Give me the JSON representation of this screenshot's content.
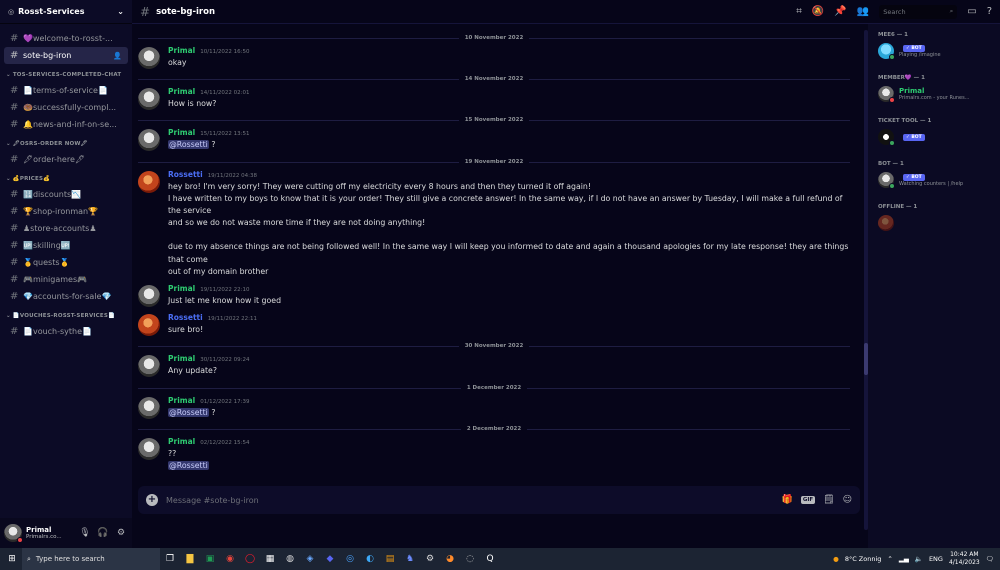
{
  "server": {
    "name": "Rosst-Services"
  },
  "sidebar": {
    "items": [
      {
        "type": "channel",
        "label": "💜welcome-to-rosst-..."
      },
      {
        "type": "channel",
        "label": "sote-bg-iron",
        "active": true
      },
      {
        "type": "category",
        "label": "TOS-SERVICES-COMPLETED-CHAT"
      },
      {
        "type": "channel",
        "label": "📄terms-of-service📄"
      },
      {
        "type": "channel",
        "label": "🍩successfully-compl..."
      },
      {
        "type": "channel",
        "label": "🔔news-and-inf-on-se..."
      },
      {
        "type": "category",
        "label": "🖋OSRS-ORDER NOW🖋"
      },
      {
        "type": "channel",
        "label": "🖋order-here🖋"
      },
      {
        "type": "category",
        "label": "💰PRICES💰"
      },
      {
        "type": "channel",
        "label": "🔢discounts📉"
      },
      {
        "type": "channel",
        "label": "🏆shop-ironman🏆"
      },
      {
        "type": "channel",
        "label": "♟store-accounts♟"
      },
      {
        "type": "channel",
        "label": "🆙skilling🆙"
      },
      {
        "type": "channel",
        "label": "🥇quests🥇"
      },
      {
        "type": "channel",
        "label": "🎮minigames🎮"
      },
      {
        "type": "channel",
        "label": "💎accounts-for-sale💎"
      },
      {
        "type": "category",
        "label": "📄VOUCHES-ROSST-SERVICES📄"
      },
      {
        "type": "channel",
        "label": "📄vouch-sythe📄"
      }
    ]
  },
  "user": {
    "name": "Primal",
    "status": "Primalrs.co..."
  },
  "channel": {
    "title": "sote-bg-iron"
  },
  "search": {
    "placeholder": "Search"
  },
  "messages": [
    {
      "type": "divider",
      "date": "10 November 2022"
    },
    {
      "type": "msg",
      "author": "Primal",
      "color": "green",
      "avatar": "gray",
      "time": "10/11/2022 16:50",
      "lines": [
        "okay"
      ]
    },
    {
      "type": "divider",
      "date": "14 November 2022"
    },
    {
      "type": "msg",
      "author": "Primal",
      "color": "green",
      "avatar": "gray",
      "time": "14/11/2022 02:01",
      "lines": [
        "How is now?"
      ]
    },
    {
      "type": "divider",
      "date": "15 November 2022"
    },
    {
      "type": "msg",
      "author": "Primal",
      "color": "green",
      "avatar": "gray",
      "time": "15/11/2022 13:51",
      "mention": "@Rossetti",
      "after": " ?"
    },
    {
      "type": "divider",
      "date": "19 November 2022"
    },
    {
      "type": "msg",
      "author": "Rossetti",
      "color": "blue",
      "avatar": "orange",
      "time": "19/11/2022 04:38",
      "lines": [
        "hey bro! I'm very sorry! They were cutting off my electricity every 8 hours and then they turned it off again!",
        "I have written to my boys to know that it is your order! They still give a concrete answer! In the same way, if I do not have an answer by Tuesday, I will make a full refund of the service",
        "and so we do not waste more time if they are not doing anything!",
        "",
        "due to my absence things are not being followed well! In the same way I will keep you informed to date and again a thousand apologies for my late response! they are things that come",
        "out of my domain brother"
      ]
    },
    {
      "type": "msg",
      "author": "Primal",
      "color": "green",
      "avatar": "gray",
      "time": "19/11/2022 22:10",
      "lines": [
        "Just let me know how it goed"
      ]
    },
    {
      "type": "msg",
      "author": "Rossetti",
      "color": "blue",
      "avatar": "orange",
      "time": "19/11/2022 22:11",
      "lines": [
        "sure bro!"
      ]
    },
    {
      "type": "divider",
      "date": "30 November 2022"
    },
    {
      "type": "msg",
      "author": "Primal",
      "color": "green",
      "avatar": "gray",
      "time": "30/11/2022 09:24",
      "lines": [
        "Any update?"
      ]
    },
    {
      "type": "divider",
      "date": "1 December 2022"
    },
    {
      "type": "msg",
      "author": "Primal",
      "color": "green",
      "avatar": "gray",
      "time": "01/12/2022 17:39",
      "mention": "@Rossetti",
      "after": " ?"
    },
    {
      "type": "divider",
      "date": "2 December 2022"
    },
    {
      "type": "msg",
      "author": "Primal",
      "color": "green",
      "avatar": "gray",
      "time": "02/12/2022 15:54",
      "lines": [
        "??"
      ],
      "mention2": "@Rossetti"
    }
  ],
  "composer": {
    "placeholder": "Message #sote-bg-iron"
  },
  "members": {
    "groups": [
      {
        "title": "MEE6 — 1",
        "entries": [
          {
            "name": "",
            "bot": "✓ BOT",
            "sub": "Playing /imagine",
            "avatar": "cyan",
            "nameColor": "white"
          }
        ]
      },
      {
        "title": "MEMBER💜 — 1",
        "entries": [
          {
            "name": "Primal",
            "bot": "",
            "sub": "Primalrs.com - your Runes...",
            "avatar": "gray",
            "nameColor": "green"
          }
        ]
      },
      {
        "title": "TICKET TOOL — 1",
        "entries": [
          {
            "name": "",
            "bot": "✓ BOT",
            "sub": "",
            "avatar": "dark",
            "nameColor": "white"
          }
        ]
      },
      {
        "title": "BOT — 1",
        "entries": [
          {
            "name": "",
            "bot": "✓ BOT",
            "sub": "Watching counters | /help",
            "avatar": "gray",
            "nameColor": "white"
          }
        ]
      },
      {
        "title": "OFFLINE — 1",
        "entries": [
          {
            "name": "",
            "bot": "",
            "sub": "",
            "avatar": "orange",
            "nameColor": "white"
          }
        ]
      }
    ]
  },
  "taskbar": {
    "search_placeholder": "Type here to search",
    "weather": "8°C  Zonnig",
    "lang": "ENG",
    "time": "10:42 AM",
    "date": "4/14/2023"
  }
}
